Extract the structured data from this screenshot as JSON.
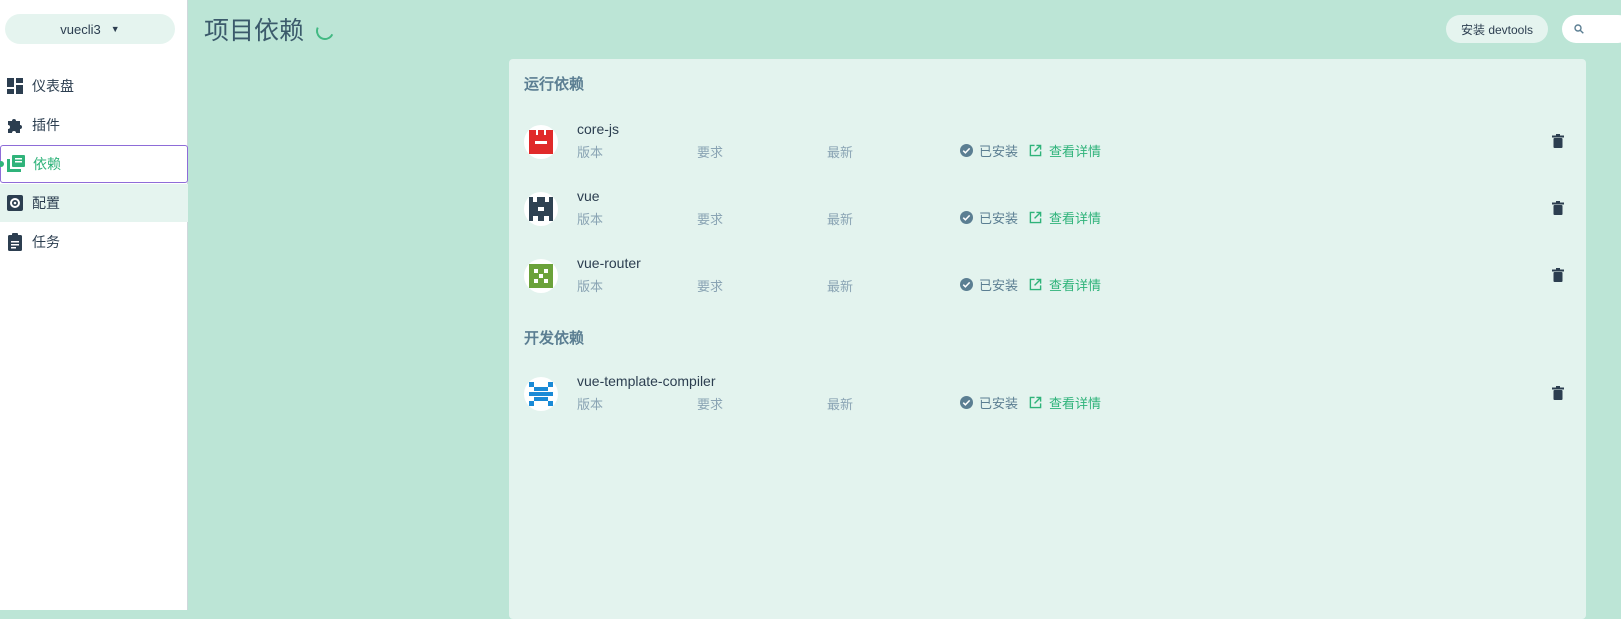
{
  "sidebar": {
    "project": {
      "name": "vuecli3",
      "caret_icon": "caret-down-icon"
    },
    "items": [
      {
        "label": "仪表盘",
        "icon": "dashboard-icon"
      },
      {
        "label": "插件",
        "icon": "puzzle-icon"
      },
      {
        "label": "依赖",
        "icon": "library-books-icon",
        "active": true
      },
      {
        "label": "配置",
        "icon": "settings-gear-icon"
      },
      {
        "label": "任务",
        "icon": "clipboard-icon"
      }
    ]
  },
  "header": {
    "title": "项目依赖",
    "devtools_button": "安装 devtools",
    "search_placeholder": ""
  },
  "sections": [
    {
      "title": "运行依赖",
      "deps": [
        {
          "name": "core-js",
          "version_label": "版本",
          "required_label": "要求",
          "latest_label": "最新",
          "status": "已安装",
          "details": "查看详情",
          "logo_color": "#e02a2a"
        },
        {
          "name": "vue",
          "version_label": "版本",
          "required_label": "要求",
          "latest_label": "最新",
          "status": "已安装",
          "details": "查看详情",
          "logo_color": "#2f4252"
        },
        {
          "name": "vue-router",
          "version_label": "版本",
          "required_label": "要求",
          "latest_label": "最新",
          "status": "已安装",
          "details": "查看详情",
          "logo_color": "#6ba23a"
        }
      ]
    },
    {
      "title": "开发依赖",
      "deps": [
        {
          "name": "vue-template-compiler",
          "version_label": "版本",
          "required_label": "要求",
          "latest_label": "最新",
          "status": "已安装",
          "details": "查看详情",
          "logo_color": "#1a8ad6"
        }
      ]
    }
  ],
  "colors": {
    "background": "#bce5d6",
    "panel": "#e3f3ee",
    "accent_green": "#2fb37a",
    "active_border": "#8e6cd8"
  }
}
